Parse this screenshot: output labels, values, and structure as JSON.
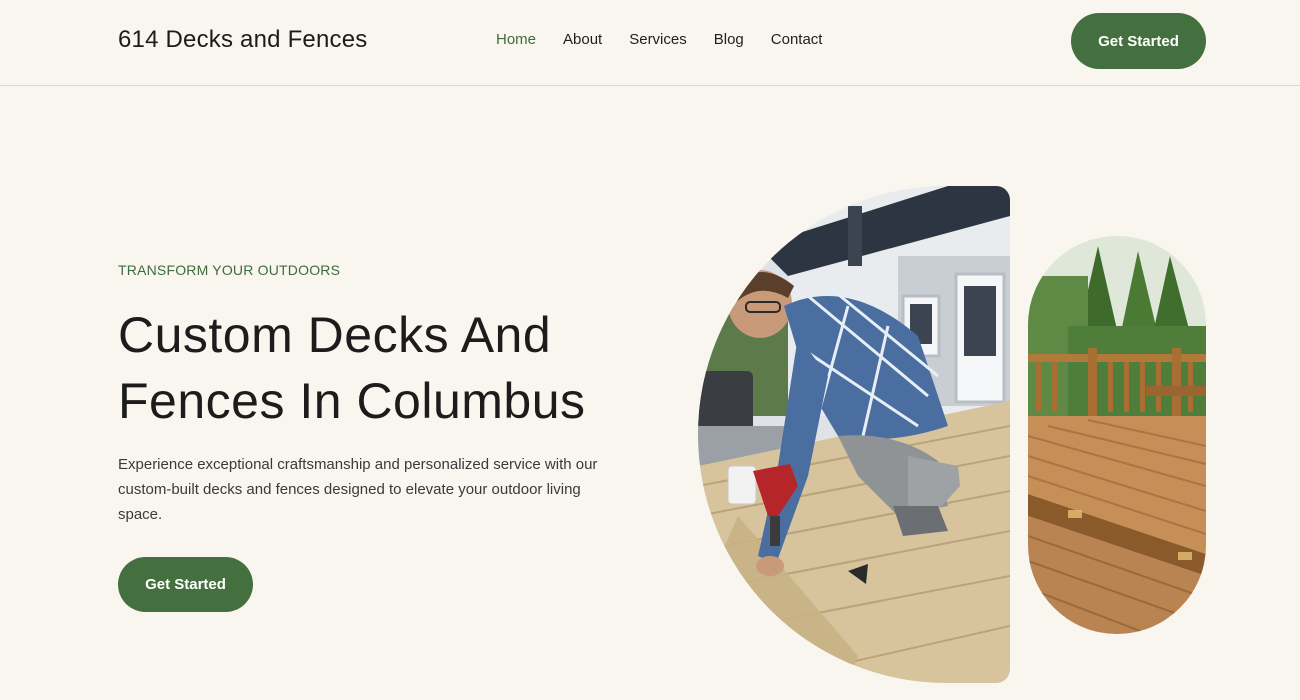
{
  "header": {
    "brand": "614 Decks and Fences",
    "nav": [
      {
        "label": "Home",
        "active": true
      },
      {
        "label": "About",
        "active": false
      },
      {
        "label": "Services",
        "active": false
      },
      {
        "label": "Blog",
        "active": false
      },
      {
        "label": "Contact",
        "active": false
      }
    ],
    "cta_label": "Get Started"
  },
  "hero": {
    "eyebrow": "TRANSFORM YOUR OUTDOORS",
    "headline": "Custom Decks And Fences In Columbus",
    "lead": "Experience exceptional craftsmanship and personalized service with our custom-built decks and fences designed to elevate your outdoor living space.",
    "cta_label": "Get Started"
  },
  "colors": {
    "background": "#f8f6ee",
    "accent": "#44703f",
    "nav_active": "#3f6b3e",
    "text": "#1c1c1c"
  }
}
